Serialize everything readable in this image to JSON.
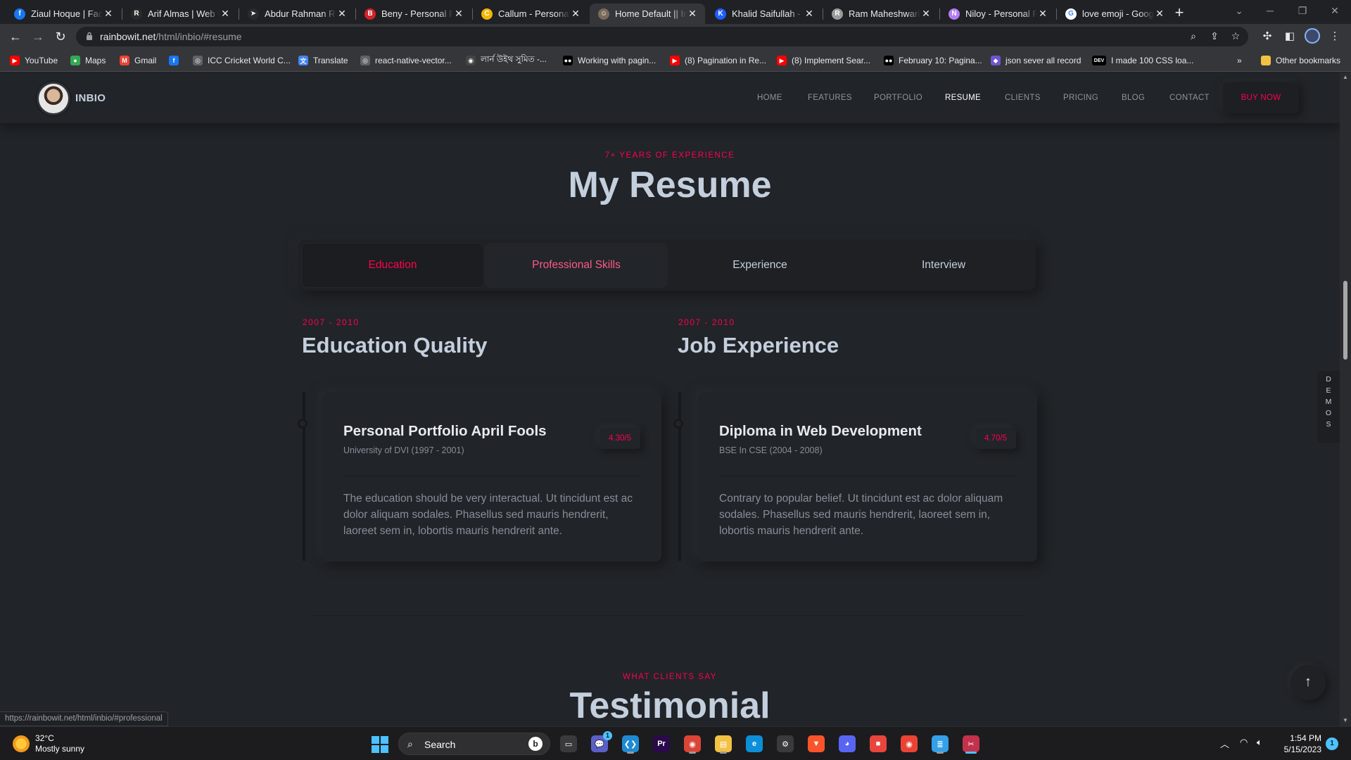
{
  "browser": {
    "tabs": [
      {
        "title": "Ziaul Hoque | Facebook",
        "icon": "facebook-icon",
        "color": "#1877f2",
        "glyph": "f"
      },
      {
        "title": "Arif Almas | Web Developer",
        "icon": "r-logo-icon",
        "color": "#2b2b2b",
        "glyph": "R"
      },
      {
        "title": "Abdur Rahman Rony",
        "icon": "paper-plane-icon",
        "color": "#2b2b2b",
        "glyph": "➤"
      },
      {
        "title": "Beny - Personal Portfolio",
        "icon": "b-logo-icon",
        "color": "#d3222a",
        "glyph": "B"
      },
      {
        "title": "Callum - Personal Portfolio",
        "icon": "c-logo-icon",
        "color": "#f2b705",
        "glyph": "C"
      },
      {
        "title": "Home Default || Inbio",
        "icon": "inbio-avatar-icon",
        "color": "#7a6a5a",
        "glyph": "☺"
      },
      {
        "title": "Khalid Saifullah - Software Engineer",
        "icon": "k-logo-icon",
        "color": "#1e5eff",
        "glyph": "K"
      },
      {
        "title": "Ram Maheshwari | Portfolio",
        "icon": "ram-avatar-icon",
        "color": "#9b9b9b",
        "glyph": "R"
      },
      {
        "title": "Niloy - Personal Portfolio",
        "icon": "n-logo-icon",
        "color": "#b57cf2",
        "glyph": "N"
      },
      {
        "title": "love emoji - Google Search",
        "icon": "google-icon",
        "color": "#ffffff",
        "glyph": "G"
      }
    ],
    "active_tab": 5,
    "url_host": "rainbowit.net",
    "url_path": "/html/inbio/#resume",
    "bookmarks": [
      {
        "label": "YouTube",
        "icon": "youtube-icon",
        "color": "#ff0000",
        "glyph": "▶"
      },
      {
        "label": "Maps",
        "icon": "maps-pin-icon",
        "color": "#34a853",
        "glyph": "●"
      },
      {
        "label": "Gmail",
        "icon": "gmail-icon",
        "color": "#ea4335",
        "glyph": "M"
      },
      {
        "label": "",
        "icon": "facebook-icon",
        "color": "#1877f2",
        "glyph": "f"
      },
      {
        "label": "ICC Cricket World C...",
        "icon": "globe-icon",
        "color": "#5f6368",
        "glyph": "◎"
      },
      {
        "label": "Translate",
        "icon": "translate-icon",
        "color": "#4285f4",
        "glyph": "文"
      },
      {
        "label": "react-native-vector...",
        "icon": "globe-icon",
        "color": "#5f6368",
        "glyph": "◎"
      },
      {
        "label": "লার্ন উইথ সুমিত -...",
        "icon": "github-icon",
        "color": "#444",
        "glyph": "◉"
      },
      {
        "label": "Working with pagin...",
        "icon": "medium-icon",
        "color": "#000",
        "glyph": "●●"
      },
      {
        "label": "(8) Pagination in Re...",
        "icon": "youtube-icon",
        "color": "#ff0000",
        "glyph": "▶"
      },
      {
        "label": "(8) Implement Sear...",
        "icon": "youtube-icon",
        "color": "#ff0000",
        "glyph": "▶"
      },
      {
        "label": "February 10: Pagina...",
        "icon": "medium-icon",
        "color": "#000",
        "glyph": "●●"
      },
      {
        "label": "json sever all record",
        "icon": "bookmark-purple-icon",
        "color": "#6e56cf",
        "glyph": "◆"
      },
      {
        "label": "I made 100 CSS loa...",
        "icon": "dev-icon",
        "color": "#000",
        "glyph": "DEV"
      }
    ],
    "other_bookmarks": "Other bookmarks",
    "status_url": "https://rainbowit.net/html/inbio/#professional"
  },
  "site": {
    "brand": "INBIO",
    "nav": [
      "HOME",
      "FEATURES",
      "PORTFOLIO",
      "RESUME",
      "CLIENTS",
      "PRICING",
      "BLOG",
      "CONTACT"
    ],
    "nav_active": "RESUME",
    "buy_now": "BUY NOW",
    "resume_subtitle": "7+ YEARS OF EXPERIENCE",
    "resume_title": "My Resume",
    "tabs": [
      "Education",
      "Professional Skills",
      "Experience",
      "Interview"
    ],
    "columns": [
      {
        "years": "2007 - 2010",
        "heading": "Education Quality",
        "card": {
          "title": "Personal Portfolio April Fools",
          "subtitle": "University of DVI (1997 - 2001)",
          "score": "4.30/5",
          "desc": "The education should be very interactual. Ut tincidunt est ac dolor aliquam sodales. Phasellus sed mauris hendrerit, laoreet sem in, lobortis mauris hendrerit ante."
        }
      },
      {
        "years": "2007 - 2010",
        "heading": "Job Experience",
        "card": {
          "title": "Diploma in Web Development",
          "subtitle": "BSE In CSE (2004 - 2008)",
          "score": "4.70/5",
          "desc": "Contrary to popular belief. Ut tincidunt est ac dolor aliquam sodales. Phasellus sed mauris hendrerit, laoreet sem in, lobortis mauris hendrerit ante."
        }
      }
    ],
    "testimonial_subtitle": "WHAT CLIENTS SAY",
    "testimonial_title": "Testimonial",
    "demos_label": [
      "D",
      "E",
      "M",
      "O",
      "S"
    ],
    "accent": "#ff014f"
  },
  "taskbar": {
    "weather_temp": "32°C",
    "weather_desc": "Mostly sunny",
    "search_label": "Search",
    "apps": [
      {
        "name": "task-view",
        "icon": "task-view-icon",
        "glyph": "▭",
        "color": "#3a3a3c"
      },
      {
        "name": "teams-chat",
        "icon": "chat-icon",
        "glyph": "💬",
        "color": "#5b5fc7"
      },
      {
        "name": "vscode",
        "icon": "vscode-icon",
        "glyph": "❮❯",
        "color": "#1f8ad2"
      },
      {
        "name": "premiere",
        "icon": "premiere-icon",
        "glyph": "Pr",
        "color": "#2a0a4a"
      },
      {
        "name": "chrome",
        "icon": "chrome-icon",
        "glyph": "◉",
        "color": "#db4437"
      },
      {
        "name": "file-explorer",
        "icon": "folder-icon",
        "glyph": "▤",
        "color": "#f3c143"
      },
      {
        "name": "edge",
        "icon": "edge-icon",
        "glyph": "e",
        "color": "#0c8fd7"
      },
      {
        "name": "app-store",
        "icon": "app-icon",
        "glyph": "⚙",
        "color": "#3a3a3c"
      },
      {
        "name": "brave",
        "icon": "brave-icon",
        "glyph": "▼",
        "color": "#fb542b"
      },
      {
        "name": "discord",
        "icon": "discord-icon",
        "glyph": "◕",
        "color": "#5865f2"
      },
      {
        "name": "camera",
        "icon": "camera-icon",
        "glyph": "■",
        "color": "#e8453c"
      },
      {
        "name": "chrome-2",
        "icon": "chrome-icon",
        "glyph": "◉",
        "color": "#ea4335"
      },
      {
        "name": "notepad",
        "icon": "notepad-icon",
        "glyph": "≣",
        "color": "#34a0e8"
      },
      {
        "name": "snipping-tool",
        "icon": "snipping-icon",
        "glyph": "✂",
        "color": "#c4314b"
      }
    ],
    "chat_badge": "1",
    "time": "1:54 PM",
    "date": "5/15/2023",
    "notification_count": "1"
  }
}
